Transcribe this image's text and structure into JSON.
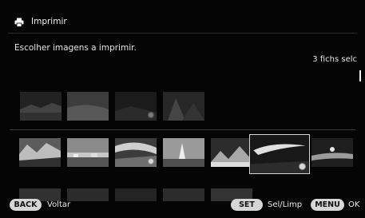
{
  "header": {
    "title": "Imprimir",
    "icon": "printer-icon"
  },
  "subtitle": "Escolher imagens a imprimir.",
  "count_label": "3 fichs selc",
  "footer": {
    "back_button": "BACK",
    "back_label": "Voltar",
    "set_button": "SET",
    "set_label": "Sel/Limp",
    "menu_button": "MENU",
    "menu_label": "OK"
  }
}
